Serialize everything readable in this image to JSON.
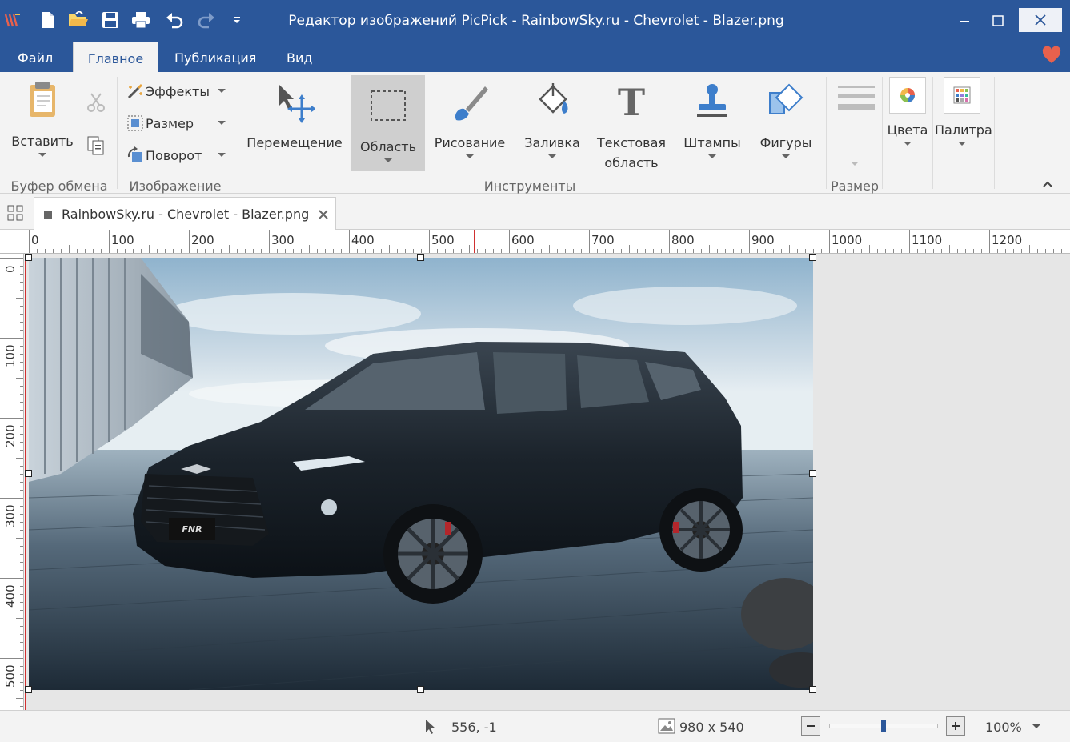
{
  "window": {
    "title": "Редактор изображений PicPick - RainbowSky.ru - Chevrolet - Blazer.png"
  },
  "quick_access": [
    "app-logo-icon",
    "new-file-icon",
    "open-file-icon",
    "save-icon",
    "print-icon",
    "undo-icon",
    "redo-icon",
    "customize-dropdown-icon"
  ],
  "menu_tabs": [
    {
      "label": "Файл",
      "active": false
    },
    {
      "label": "Главное",
      "active": true
    },
    {
      "label": "Публикация",
      "active": false
    },
    {
      "label": "Вид",
      "active": false
    }
  ],
  "ribbon": {
    "clipboard": {
      "paste_label": "Вставить",
      "group_label": "Буфер обмена"
    },
    "image": {
      "effects_label": "Эффекты",
      "resize_label": "Размер",
      "rotate_label": "Поворот",
      "group_label": "Изображение"
    },
    "tools": {
      "move_label": "Перемещение",
      "area_label": "Область",
      "drawing_label": "Рисование",
      "fill_label": "Заливка",
      "text_label_1": "Текстовая",
      "text_label_2": "область",
      "stamps_label": "Штампы",
      "shapes_label": "Фигуры",
      "group_label": "Инструменты"
    },
    "size": {
      "group_label": "Размер"
    },
    "colors_label": "Цвета",
    "palette_label": "Палитра"
  },
  "document_tab": {
    "title": "RainbowSky.ru - Chevrolet - Blazer.png"
  },
  "ruler": {
    "horizontal_labels": [
      "0",
      "100",
      "200",
      "300",
      "400",
      "500",
      "600",
      "700",
      "800",
      "900",
      "1000",
      "1100",
      "1200"
    ],
    "vertical_labels": [
      "0",
      "100",
      "200",
      "300",
      "400",
      "500"
    ]
  },
  "status": {
    "cursor_position": "556, -1",
    "image_size": "980 x 540",
    "zoom": "100%",
    "zoom_level": 0.5
  },
  "colors": {
    "accent": "#2b579a",
    "heart": "#e8614d"
  }
}
